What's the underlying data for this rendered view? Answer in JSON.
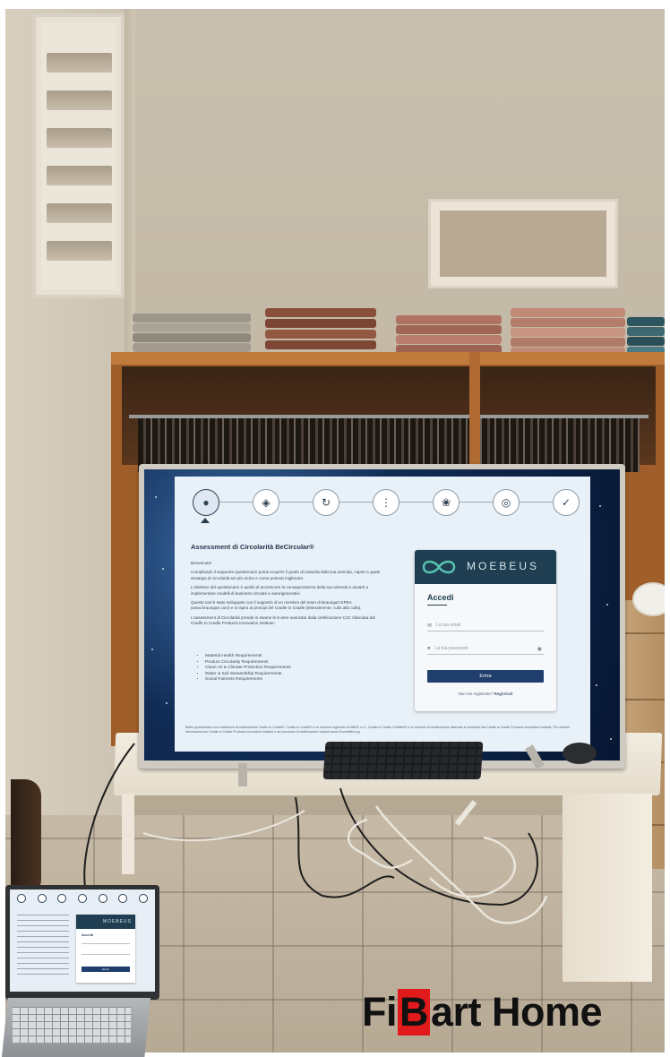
{
  "screen_app": {
    "steps": [
      "user-icon",
      "tag-icon",
      "recycle-icon",
      "people-icon",
      "hand-leaf-icon",
      "globe-hands-icon",
      "check-icon"
    ],
    "title": "Assessment di Circolarità BeCircular®",
    "paragraphs": [
      "Benvenuto!",
      "Compilando il seguente questionario potrai scoprire il grado di maturità della tua azienda, capire a quale strategia di circolarità sei più vicino e come potresti migliorare.",
      "L'obiettivo del questionario è quello di accrescere la consapevolezza della tua azienda e aiutarti a implementare modelli di business circolari e autorigenerativi.",
      "Questo tool è stato sviluppato con il supporto di un membro del team di Braungart EPEA (www.braungart.com) e si ispira ai principi del Cradle to Cradle (letteralmente: culla alla culla).",
      "L'assessment di Circolarità prende in esame le 5 aree avanzate dalla certificazione C2C rilasciata dal Cradle to Cradle Products Innovation Institute:"
    ],
    "list": [
      "Material Health Requirements",
      "Product Circularity Requirements",
      "Clean Air & Climate Protection Requirements",
      "Water & Soil Stewardship Requirements",
      "Social Fairness Requirements"
    ],
    "footer": "BeMo questionario non sostituisce la certificazione Cradle to Cradle®. Cradle to Cradle® è un marchio registrato di MBDC LLC. Cradle to Cradle Certified® è un marchio di certificazione rilasciato in esclusiva dal Cradle to Cradle Products Innovation Institute. Per ulteriori informazioni sul Cradle to Cradle Products Innovation Institute e sul processo di certificazione visitare www.c2ccertified.org",
    "login": {
      "brand": "MOEBEUS",
      "heading": "Accedi",
      "email_placeholder": "La tua email",
      "password_placeholder": "La tua password",
      "submit_label": "Entra",
      "register_text": "Non sei registrato?",
      "register_link": "Registrati"
    }
  },
  "laptop_screen": {
    "brand": "MOEBEUS",
    "heading": "Accedi",
    "submit_label": "Entra"
  },
  "watermark": {
    "part1": "Fi",
    "part2": "B",
    "part3": "art Home",
    "accent_color": "#e11b1b"
  }
}
